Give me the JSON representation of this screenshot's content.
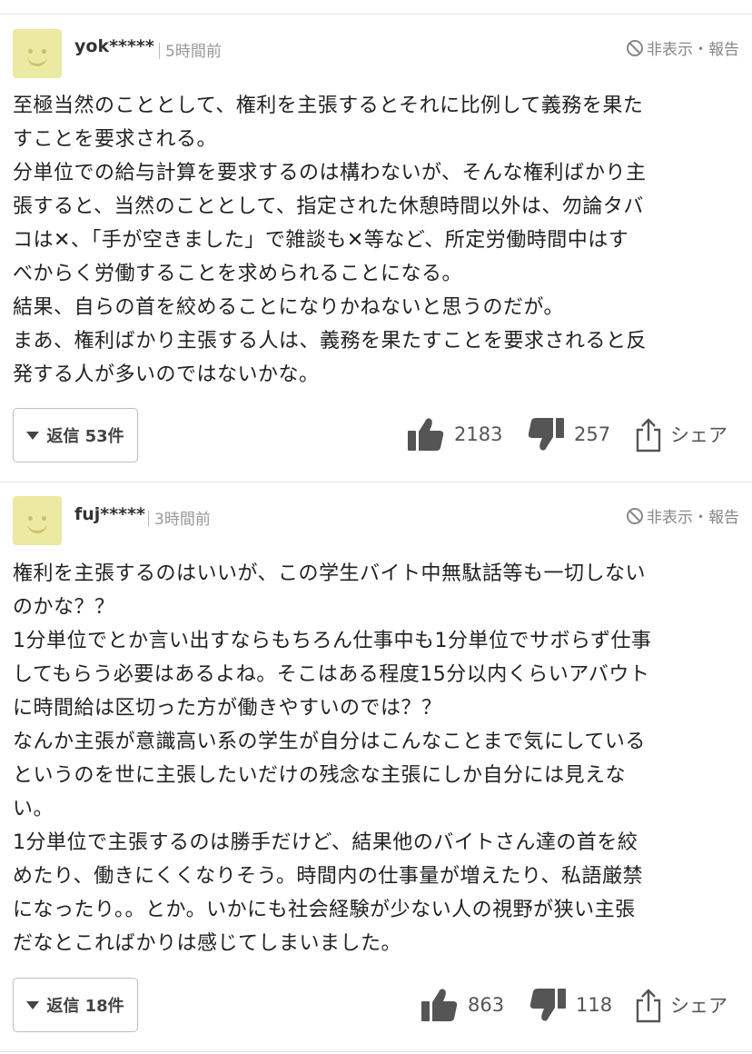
{
  "comments": [
    {
      "user": "yok*****",
      "time": "5時間前",
      "hide_report": "非表示・報告",
      "lines": [
        "至極当然のこととして、権利を主張するとそれに比例して義務を果た",
        "すことを要求される。",
        "分単位での給与計算を要求するのは構わないが、そんな権利ばかり主",
        "張すると、当然のこととして、指定された休憩時間以外は、勿論タバ",
        "コは✕、「手が空きました」で雑談も✕等など、所定労働時間中はす",
        "べからく労働することを求められることになる。",
        "結果、自らの首を絞めることになりかねないと思うのだが。",
        "まあ、権利ばかり主張する人は、義務を果たすことを要求されると反",
        "発する人が多いのではないかな。"
      ],
      "reply_label": "返信 53件",
      "likes": "2183",
      "dislikes": "257",
      "share": "シェア"
    },
    {
      "user": "fuj*****",
      "time": "3時間前",
      "hide_report": "非表示・報告",
      "lines": [
        "権利を主張するのはいいが、この学生バイト中無駄話等も一切しない",
        "のかな？？",
        "1分単位でとか言い出すならもちろん仕事中も1分単位でサボらず仕事",
        "してもらう必要はあるよね。そこはある程度15分以内くらいアバウト",
        "に時間給は区切った方が働きやすいのでは？？",
        "なんか主張が意識高い系の学生が自分はこんなことまで気にしている",
        "というのを世に主張したいだけの残念な主張にしか自分には見えな",
        "い。",
        "1分単位で主張するのは勝手だけど、結果他のバイトさん達の首を絞",
        "めたり、働きにくくなりそう。時間内の仕事量が増えたり、私語厳禁",
        "になったり。。とか。いかにも社会経験が少ない人の視野が狭い主張",
        "だなとこればかりは感じてしまいました。"
      ],
      "reply_label": "返信 18件",
      "likes": "863",
      "dislikes": "118",
      "share": "シェア"
    }
  ],
  "colors": {
    "avatar_bg": "#ece9a2",
    "avatar_face": "#c9c06a",
    "icon_gray": "#555555"
  },
  "icons": [
    "hide-icon",
    "thumbs-up-icon",
    "thumbs-down-icon",
    "share-icon",
    "caret-down-icon"
  ]
}
